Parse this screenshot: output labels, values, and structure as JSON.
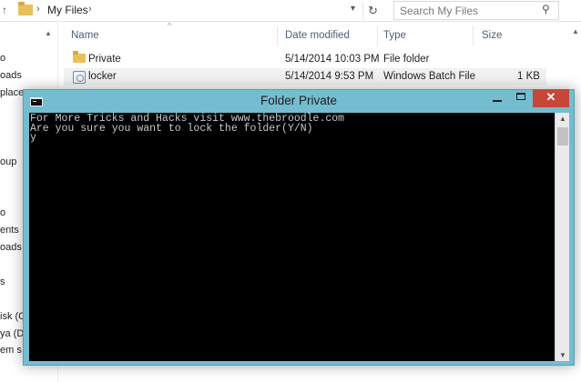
{
  "explorer": {
    "address": {
      "path_label": "My Files",
      "separator": "›"
    },
    "search": {
      "placeholder": "Search My Files"
    },
    "nav": [
      "o",
      "oads",
      "place",
      "oup",
      "o",
      "ents",
      "oads",
      "s",
      "isk (C",
      "ya (D",
      "em s"
    ],
    "columns": {
      "name": "Name",
      "date": "Date modified",
      "type": "Type",
      "size": "Size"
    },
    "rows": [
      {
        "name": "Private",
        "date": "5/14/2014 10:03 PM",
        "type": "File folder",
        "size": "",
        "icon": "folder-icon"
      },
      {
        "name": "locker",
        "date": "5/14/2014 9:53 PM",
        "type": "Windows Batch File",
        "size": "1 KB",
        "icon": "batch-file-icon"
      }
    ]
  },
  "console": {
    "title": "Folder Private",
    "controls": {
      "close": "✕"
    },
    "lines": [
      "For More Tricks and Hacks visit www.thebroodle.com",
      "Are you sure you want to lock the folder(Y/N)",
      "y"
    ]
  },
  "colors": {
    "titlebar": "#74bdd1",
    "close_button": "#c7463a",
    "console_bg": "#000000",
    "console_text": "#c7c7c7"
  }
}
